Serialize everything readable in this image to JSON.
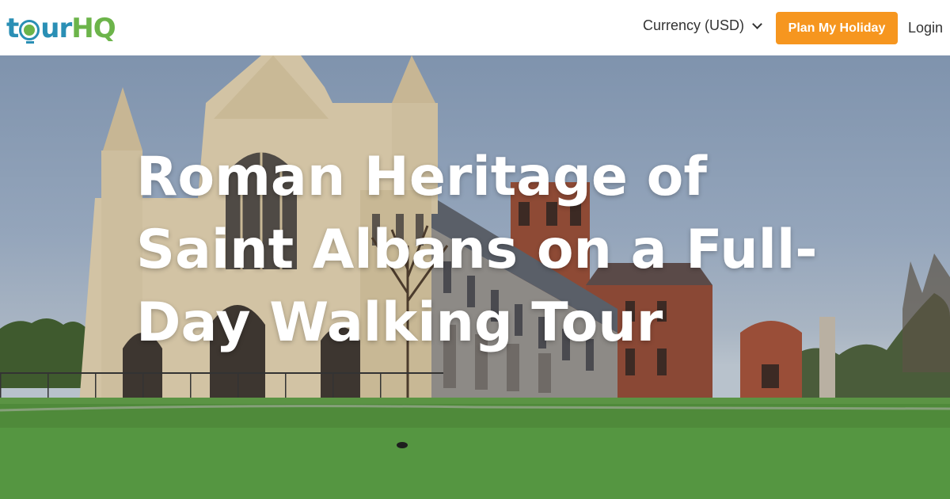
{
  "header": {
    "logo_text_1": "t",
    "logo_text_2": "ur",
    "logo_text_3": "HQ",
    "currency_label": "Currency (USD)",
    "plan_button_label": "Plan My Holiday",
    "login_label": "Login"
  },
  "hero": {
    "title": "Roman Heritage of Saint Albans on a Full-Day Walking Tour",
    "image_subject": "St Albans Cathedral"
  },
  "colors": {
    "brand_blue": "#2a8fb5",
    "brand_green": "#6cb44a",
    "accent_orange": "#f6961f"
  },
  "icons": [
    "globe-logo-icon",
    "chevron-down-icon"
  ]
}
